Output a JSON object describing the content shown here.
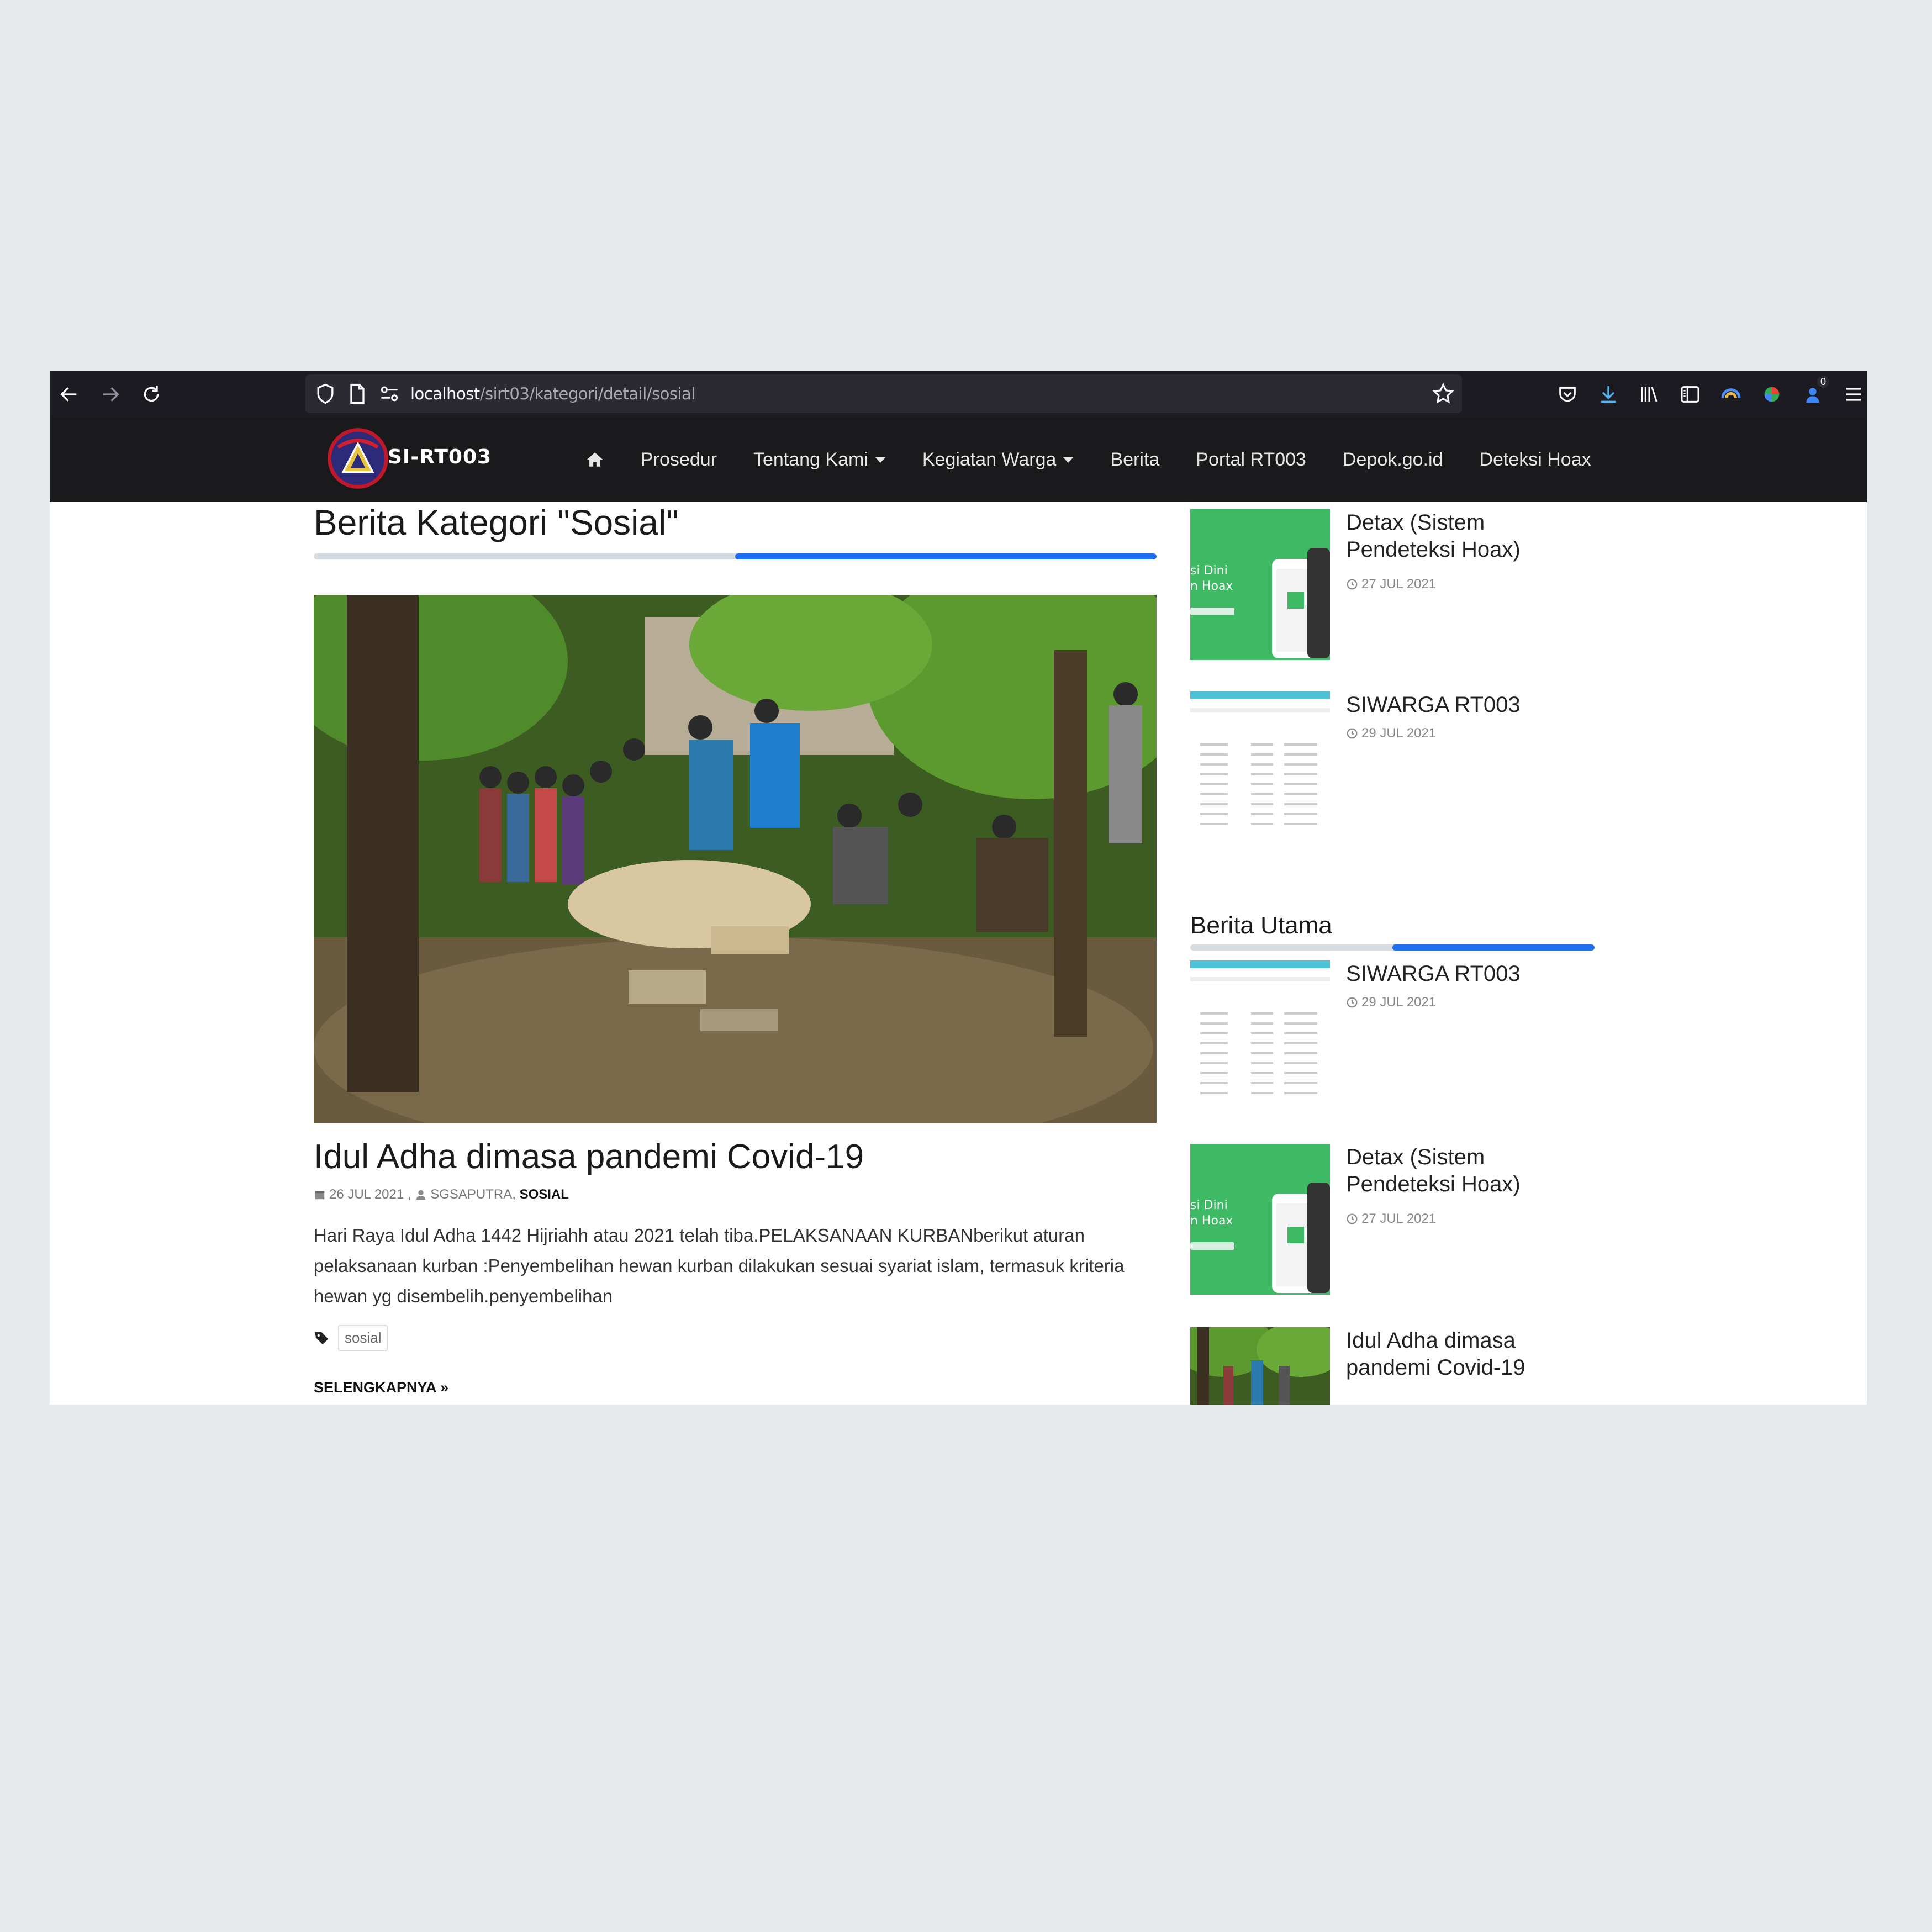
{
  "browser": {
    "url_host": "localhost",
    "url_path": "/sirt03/kategori/detail/sosial",
    "download_badge": "0"
  },
  "site": {
    "brand": "SI-RT003",
    "nav": [
      {
        "label": "Prosedur"
      },
      {
        "label": "Tentang Kami",
        "dropdown": true
      },
      {
        "label": "Kegiatan Warga",
        "dropdown": true
      },
      {
        "label": "Berita"
      },
      {
        "label": "Portal RT003"
      },
      {
        "label": "Depok.go.id"
      },
      {
        "label": "Deteksi Hoax"
      }
    ]
  },
  "page": {
    "title": "Berita Kategori \"Sosial\"",
    "post": {
      "title": "Idul Adha dimasa pandemi Covid-19",
      "date": "26 JUL 2021",
      "author": "SGSAPUTRA",
      "category": "SOSIAL",
      "excerpt": "Hari Raya Idul Adha 1442 Hijriahh atau 2021 telah tiba.PELAKSANAAN KURBANberikut aturan pelaksanaan kurban :Penyembelihan hewan kurban dilakukan sesuai syariat islam, termasuk kriteria hewan yg disembelih.penyembelihan",
      "tag": "sosial",
      "read_more": "SELENGKAPNYA"
    }
  },
  "sidebar": {
    "recent": [
      {
        "title": "Detax (Sistem Pendeteksi Hoax)",
        "date": "27 JUL 2021",
        "thumb": "detax"
      },
      {
        "title": "SIWARGA RT003",
        "date": "29 JUL 2021",
        "thumb": "siwarga"
      }
    ],
    "heading": "Berita Utama",
    "featured": [
      {
        "title": "SIWARGA RT003",
        "date": "29 JUL 2021",
        "thumb": "siwarga"
      },
      {
        "title": "Detax (Sistem Pendeteksi Hoax)",
        "date": "27 JUL 2021",
        "thumb": "detax"
      },
      {
        "title": "Idul Adha dimasa pandemi Covid-19",
        "date": "",
        "thumb": "idul-adha"
      }
    ],
    "thumb_text": {
      "detax_line1": "si Dini",
      "detax_line2": "n Hoax"
    }
  },
  "colors": {
    "accent": "#1e6ff2",
    "navbar": "#1a1a1c",
    "chrome": "#1c1b22",
    "detax_green": "#3dba63"
  }
}
